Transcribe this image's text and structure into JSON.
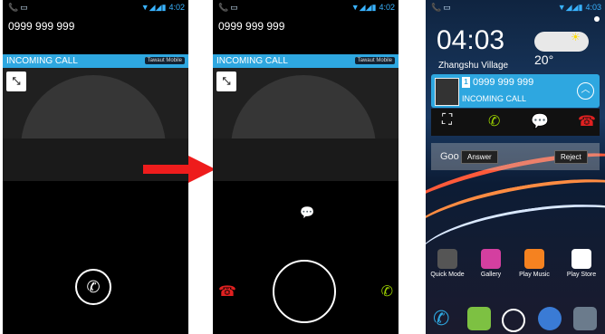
{
  "colors": {
    "accent": "#2ea7e0",
    "answer": "#9bd100",
    "decline": "#e02020",
    "arrow": "#ee1c1c"
  },
  "screen1": {
    "status_time": "4:02",
    "caller_number": "0999 999 999",
    "incoming_label": "INCOMING CALL",
    "carrier": "Tawaut Mobile"
  },
  "screen2": {
    "status_time": "4:02",
    "caller_number": "0999 999 999",
    "incoming_label": "INCOMING CALL",
    "carrier": "Tawaut Mobile"
  },
  "screen3": {
    "status_time": "4:03",
    "clock": "04:03",
    "location": "Zhangshu Village",
    "temperature": "20°",
    "notification": {
      "number": "0999 999 999",
      "sim": "1",
      "label": "INCOMING CALL"
    },
    "search_logo": "Goo",
    "tips": {
      "answer": "Answer",
      "reject": "Reject"
    },
    "apps": [
      {
        "label": "Quick Mode",
        "icon": "quick-mode-icon",
        "color": "#555555"
      },
      {
        "label": "Gallery",
        "icon": "gallery-icon",
        "color": "#d43fa0"
      },
      {
        "label": "Play Music",
        "icon": "play-music-icon",
        "color": "#f58220"
      },
      {
        "label": "Play Store",
        "icon": "play-store-icon",
        "color": "#ffffff"
      }
    ]
  }
}
